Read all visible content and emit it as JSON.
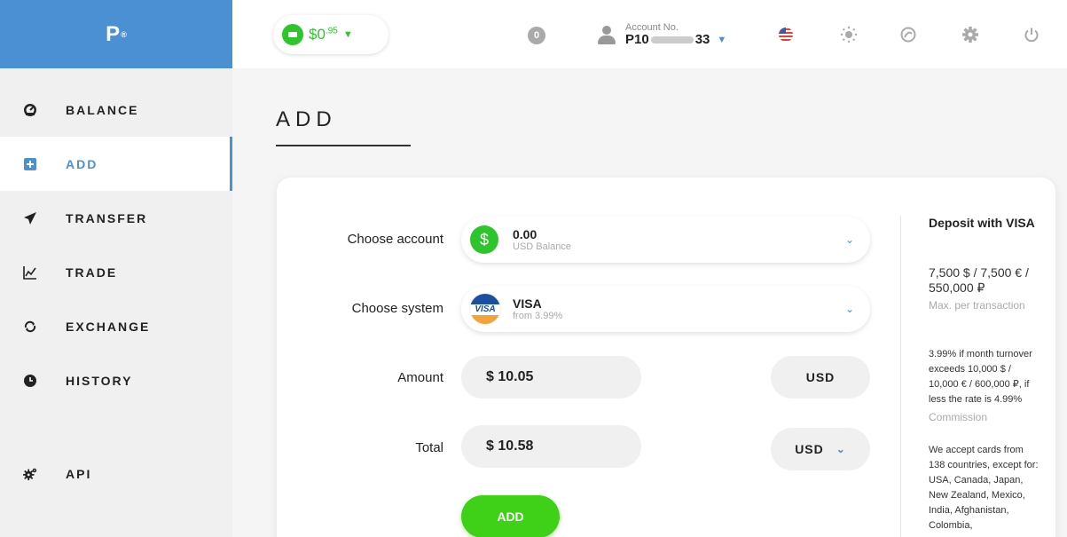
{
  "sidebar": {
    "logo": "P",
    "logo_mark": "®",
    "items": [
      {
        "label": "BALANCE",
        "icon": "dashboard-icon"
      },
      {
        "label": "ADD",
        "icon": "plus-square-icon"
      },
      {
        "label": "TRANSFER",
        "icon": "paper-plane-icon"
      },
      {
        "label": "TRADE",
        "icon": "chart-line-icon"
      },
      {
        "label": "EXCHANGE",
        "icon": "exchange-arrows-icon"
      },
      {
        "label": "HISTORY",
        "icon": "clock-icon"
      },
      {
        "label": "API",
        "icon": "gears-icon"
      }
    ],
    "active_label": "ADD"
  },
  "header": {
    "balance_main": "$0",
    "balance_cents": ".95",
    "notifications": "0",
    "account_label": "Account No.",
    "account_prefix": "P10",
    "account_suffix": "33",
    "icons": [
      "us-flag-icon",
      "brightness-icon",
      "support-icon",
      "settings-gear-icon",
      "power-icon"
    ]
  },
  "main": {
    "title": "ADD",
    "form": {
      "account_label": "Choose account",
      "account_value": "0.00",
      "account_sub": "USD Balance",
      "account_symbol": "$",
      "system_label": "Choose system",
      "system_value": "VISA",
      "system_sub": "from 3.99%",
      "system_logo_text": "VISA",
      "amount_label": "Amount",
      "amount_value": "$ 10.05",
      "amount_currency": "USD",
      "total_label": "Total",
      "total_value": "$ 10.58",
      "total_currency": "USD",
      "submit_label": "ADD"
    },
    "info": {
      "title": "Deposit with VISA",
      "max_value": "7,500 $ / 7,500 € / 550,000 ₽",
      "max_label": "Max. per transaction",
      "commission_text": "3.99% if month turnover exceeds 10,000 $ / 10,000 € / 600,000 ₽, if less the rate is 4.99%",
      "commission_label": "Commission",
      "countries_text": "We accept cards from 138 countries, except for: USA, Canada, Japan, New Zealand, Mexico, India, Afghanistan, Colombia,"
    }
  },
  "colors": {
    "accent": "#4a90d2",
    "green": "#3ed118",
    "sidebar_bg": "#f0f0f0"
  }
}
